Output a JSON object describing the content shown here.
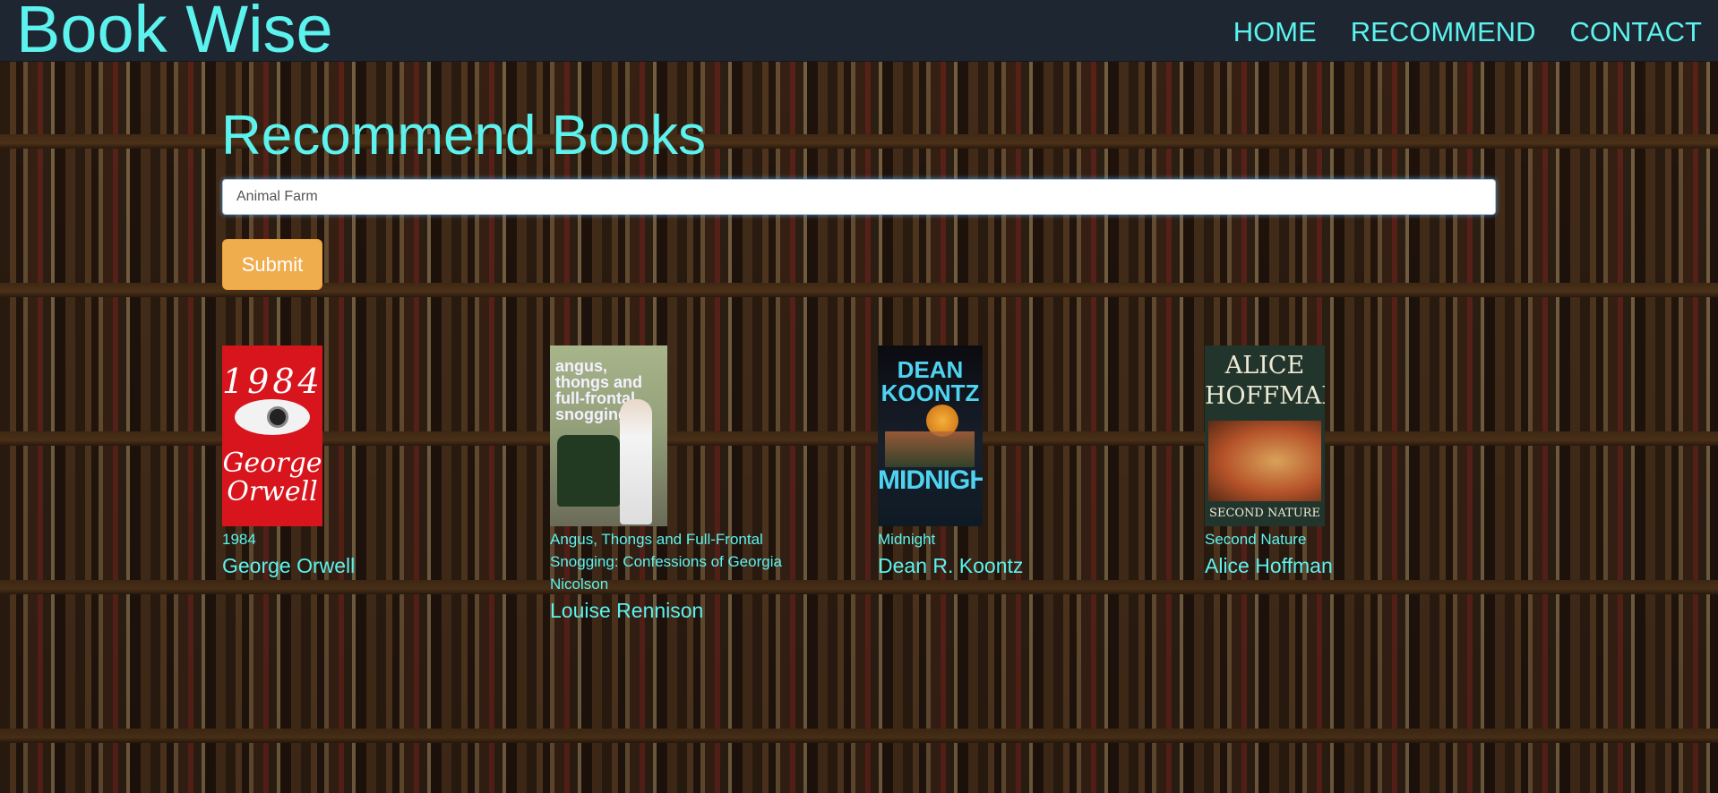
{
  "app": {
    "brand": "Book Wise"
  },
  "nav": {
    "items": [
      {
        "label": "HOME"
      },
      {
        "label": "RECOMMEND"
      },
      {
        "label": "CONTACT"
      }
    ]
  },
  "main": {
    "title": "Recommend Books",
    "search": {
      "value": "Animal Farm"
    },
    "submit_label": "Submit"
  },
  "books": [
    {
      "title": "1984",
      "author": "George Orwell",
      "cover": {
        "line1": "1984",
        "line2": "George",
        "line3": "Orwell"
      }
    },
    {
      "title": "Angus, Thongs and Full-Frontal Snogging: Confessions of Georgia Nicolson",
      "author": "Louise Rennison",
      "cover": {
        "line1": "angus, thongs and full-frontal snogging"
      }
    },
    {
      "title": "Midnight",
      "author": "Dean R. Koontz",
      "cover": {
        "line1": "DEAN KOONTZ",
        "line2": "MIDNIGHT"
      }
    },
    {
      "title": "Second Nature",
      "author": "Alice Hoffman",
      "cover": {
        "line1": "ALICE HOFFMAN",
        "line2": "SECOND NATURE"
      }
    }
  ],
  "colors": {
    "accent": "#5cf2ee",
    "navbar": "#1e2631",
    "submit": "#f0ad4e"
  }
}
